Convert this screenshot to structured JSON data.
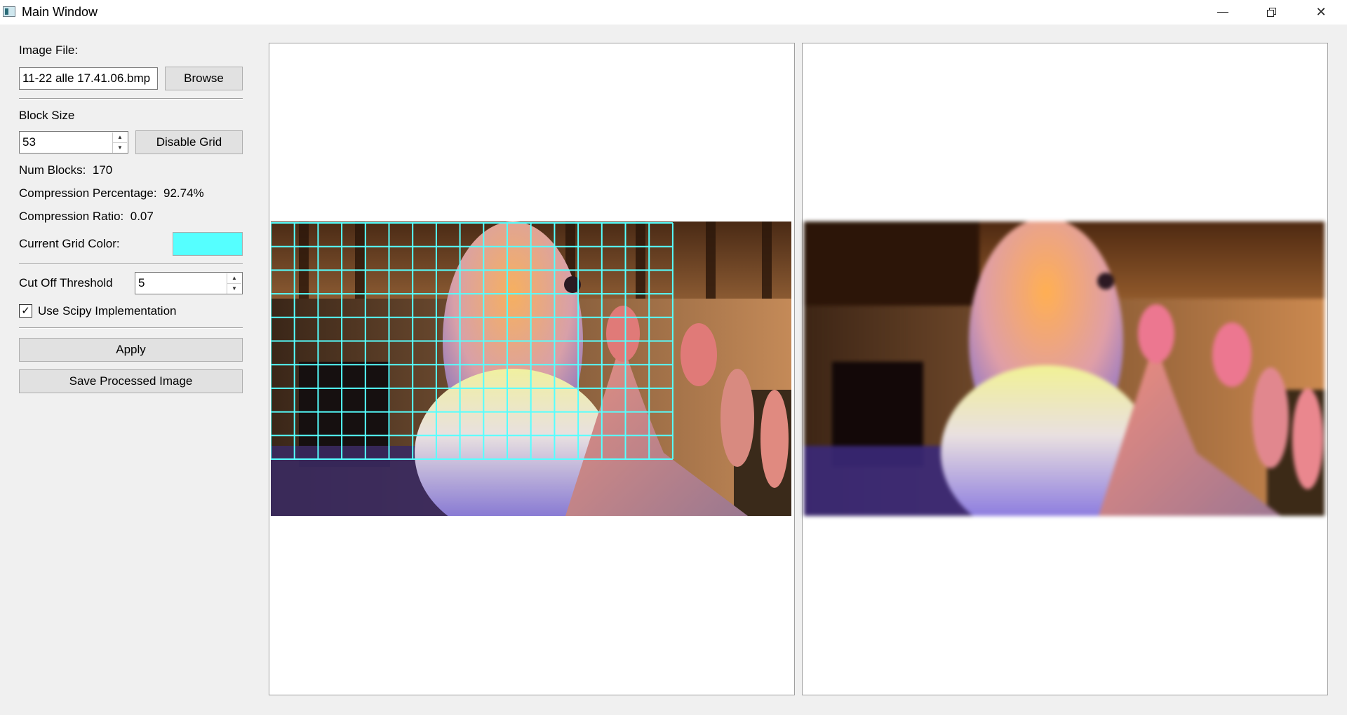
{
  "window": {
    "title": "Main Window"
  },
  "image_file": {
    "label": "Image File:",
    "value": "11-22 alle 17.41.06.bmp",
    "browse_label": "Browse"
  },
  "block_size": {
    "label": "Block Size",
    "value": "53",
    "toggle_grid_label": "Disable Grid"
  },
  "stats": {
    "num_blocks_label": "Num Blocks:",
    "num_blocks_value": "170",
    "compression_percentage_label": "Compression Percentage:",
    "compression_percentage_value": "92.74%",
    "compression_ratio_label": "Compression Ratio:",
    "compression_ratio_value": "0.07"
  },
  "grid_color": {
    "label": "Current Grid Color:",
    "color": "#55ffff"
  },
  "threshold": {
    "label": "Cut Off Threshold",
    "value": "5"
  },
  "scipy": {
    "label": "Use Scipy Implementation",
    "checked": true
  },
  "actions": {
    "apply_label": "Apply",
    "save_label": "Save Processed Image"
  },
  "grid_overlay": {
    "columns": 17,
    "rows": 10,
    "color": "#55ffff"
  }
}
